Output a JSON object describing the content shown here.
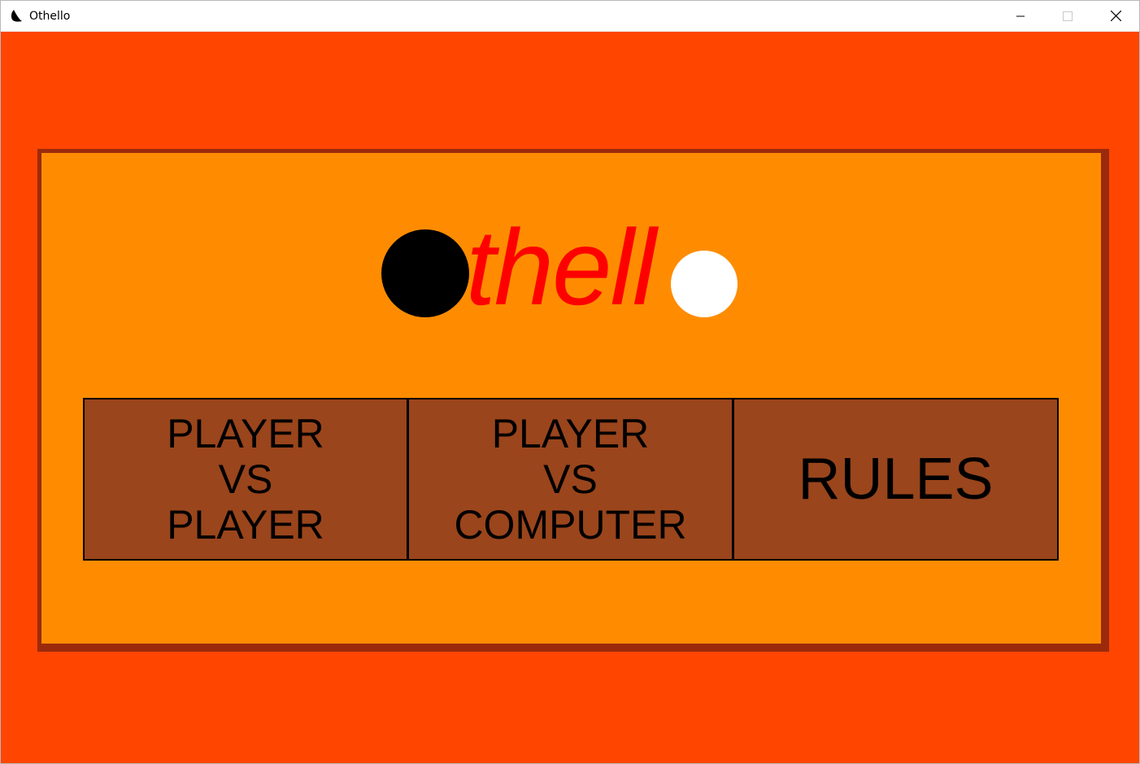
{
  "window": {
    "title": "Othello",
    "icon": "othello-app-icon",
    "controls": [
      "minimize-icon",
      "maximize-icon",
      "close-icon"
    ]
  },
  "logo": {
    "text": "thell"
  },
  "menu": {
    "player_vs_player": [
      "PLAYER",
      "VS",
      "PLAYER"
    ],
    "player_vs_computer": [
      "PLAYER",
      "VS",
      "COMPUTER"
    ],
    "rules": "RULES"
  },
  "colors": {
    "background": "#ff4500",
    "board": "#ff8c00",
    "board_border": "#9b2a0c",
    "button": "#9a451c",
    "logo_text": "#ff0000"
  }
}
